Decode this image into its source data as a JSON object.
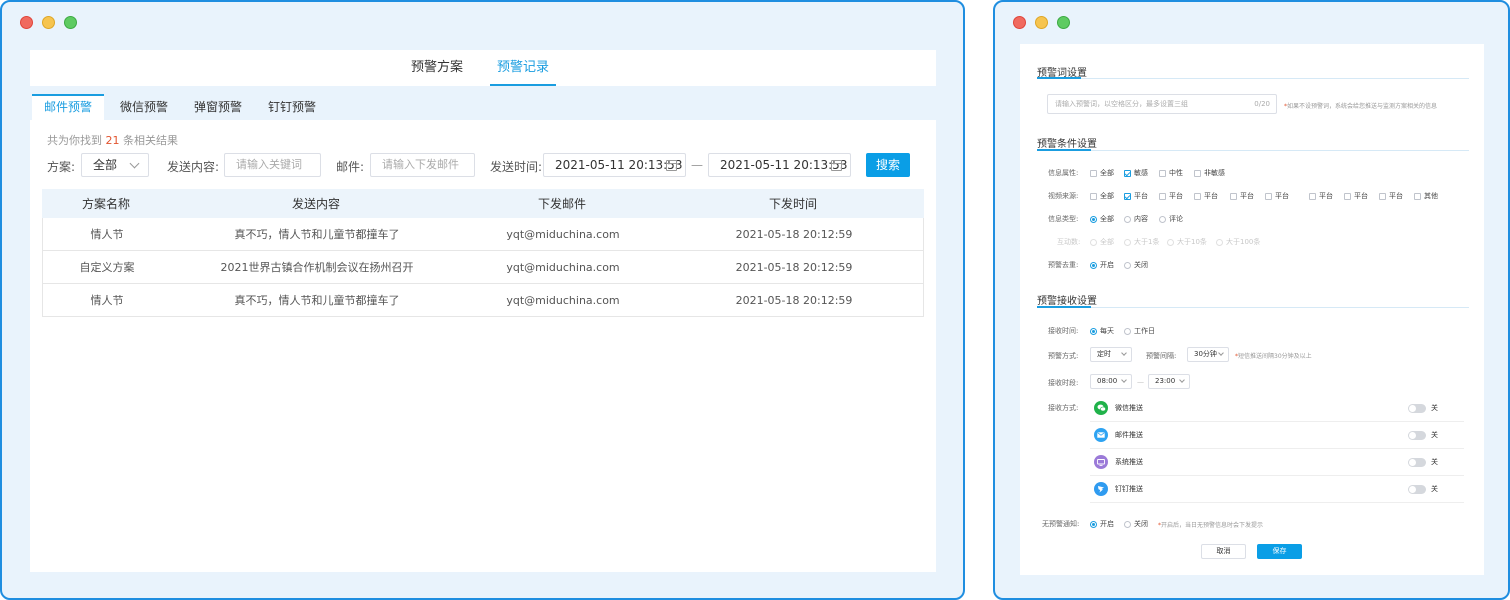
{
  "records_window": {
    "top_tabs": [
      {
        "label": "预警方案",
        "active": false
      },
      {
        "label": "预警记录",
        "active": true
      }
    ],
    "sub_tabs": [
      {
        "label": "邮件预警",
        "active": true
      },
      {
        "label": "微信预警",
        "active": false
      },
      {
        "label": "弹窗预警",
        "active": false
      },
      {
        "label": "钉钉预警",
        "active": false
      }
    ],
    "result_prefix": "共为你找到",
    "result_count": "21",
    "result_suffix": "条相关结果",
    "filters": {
      "plan_label": "方案:",
      "plan_value": "全部",
      "content_label": "发送内容:",
      "content_placeholder": "请输入关键词",
      "email_label": "邮件:",
      "email_placeholder": "请输入下发邮件",
      "time_label": "发送时间:",
      "time_start": "2021-05-11 20:13:53",
      "time_separator": "—",
      "time_end": "2021-05-11 20:13:53",
      "search_button": "搜索"
    },
    "table": {
      "columns": [
        "方案名称",
        "发送内容",
        "下发邮件",
        "下发时间"
      ],
      "rows": [
        [
          "情人节",
          "真不巧，情人节和儿童节都撞车了",
          "yqt@miduchina.com",
          "2021-05-18 20:12:59"
        ],
        [
          "自定义方案",
          "2021世界古镇合作机制会议在扬州召开",
          "yqt@miduchina.com",
          "2021-05-18 20:12:59"
        ],
        [
          "情人节",
          "真不巧，情人节和儿童节都撞车了",
          "yqt@miduchina.com",
          "2021-05-18 20:12:59"
        ]
      ]
    }
  },
  "settings_window": {
    "keyword_section": {
      "title": "预警词设置",
      "input_placeholder": "请输入预警词，以空格区分，最多设置三组",
      "counter": "0/20",
      "tip_star": "*",
      "tip": "如果不设预警词，系统会给您推送与监测方案相关的信息"
    },
    "condition_section": {
      "title": "预警条件设置",
      "info_attr": {
        "label": "信息属性:",
        "options": [
          {
            "label": "全部",
            "checked": false
          },
          {
            "label": "敏感",
            "checked": true
          },
          {
            "label": "中性",
            "checked": false
          },
          {
            "label": "非敏感",
            "checked": false
          }
        ]
      },
      "video_source": {
        "label": "视频来源:",
        "options": [
          {
            "label": "全部",
            "checked": false
          },
          {
            "label": "平台",
            "checked": true
          },
          {
            "label": "平台",
            "checked": false
          },
          {
            "label": "平台",
            "checked": false
          },
          {
            "label": "平台",
            "checked": false
          },
          {
            "label": "平台",
            "checked": false
          },
          {
            "label": "平台",
            "checked": false
          },
          {
            "label": "平台",
            "checked": false
          },
          {
            "label": "平台",
            "checked": false
          },
          {
            "label": "其他",
            "checked": false
          }
        ]
      },
      "info_type": {
        "label": "信息类型:",
        "options": [
          {
            "label": "全部",
            "selected": true
          },
          {
            "label": "内容",
            "selected": false
          },
          {
            "label": "评论",
            "selected": false
          }
        ]
      },
      "interaction": {
        "label": "互动数:",
        "options": [
          {
            "label": "全部",
            "selected": true
          },
          {
            "label": "大于1条",
            "selected": false
          },
          {
            "label": "大于10条",
            "selected": false
          },
          {
            "label": "大于100条",
            "selected": false
          }
        ]
      },
      "dedupe": {
        "label": "预警去重:",
        "options": [
          {
            "label": "开启",
            "selected": true
          },
          {
            "label": "关闭",
            "selected": false
          }
        ]
      }
    },
    "receive_section": {
      "title": "预警接收设置",
      "receive_time": {
        "label": "接收时间:",
        "options": [
          {
            "label": "每天",
            "selected": true
          },
          {
            "label": "工作日",
            "selected": false
          }
        ]
      },
      "mode": {
        "label": "预警方式:",
        "value": "定时"
      },
      "interval": {
        "label": "预警间隔:",
        "value": "30分钟"
      },
      "interval_tip_star": "*",
      "interval_tip": "短信推送间隔30分钟及以上",
      "period": {
        "label": "接收时段:",
        "start": "08:00",
        "separator": "—",
        "end": "23:00"
      },
      "methods_label": "接收方式:",
      "methods": [
        {
          "name": "微信推送",
          "icon": "wechat-icon",
          "color": "#20b24a",
          "state": "关"
        },
        {
          "name": "邮件推送",
          "icon": "mail-icon",
          "color": "#2ea3f2",
          "state": "关"
        },
        {
          "name": "系统推送",
          "icon": "monitor-icon",
          "color": "#9b7ad8",
          "state": "关"
        },
        {
          "name": "钉钉推送",
          "icon": "dingtalk-icon",
          "color": "#2f9bf0",
          "state": "关"
        }
      ],
      "no_alert": {
        "label": "无预警通知:",
        "options": [
          {
            "label": "开启",
            "selected": true
          },
          {
            "label": "关闭",
            "selected": false
          }
        ]
      },
      "no_alert_tip_star": "*",
      "no_alert_tip": "开启后，当日无预警信息时会下发提示"
    },
    "buttons": {
      "cancel": "取消",
      "save": "保存"
    }
  },
  "colors": {
    "accent": "#1a9de0",
    "primary_button": "#0a9ee6",
    "window_border": "#1f8ee0",
    "highlight_number": "#e2542f"
  }
}
